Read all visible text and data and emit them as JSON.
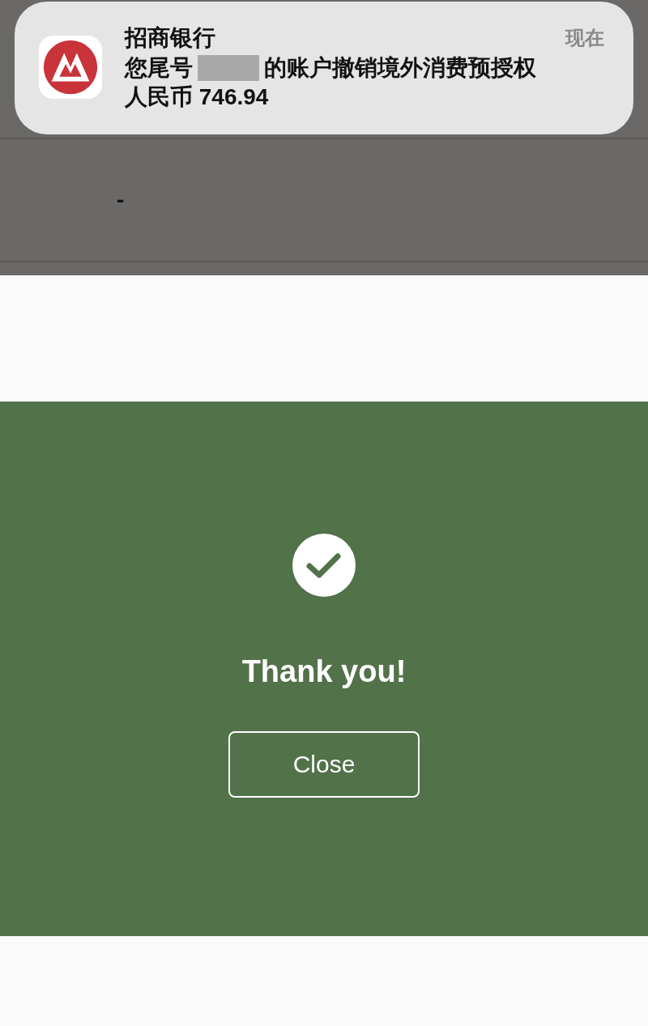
{
  "notification": {
    "app_name": "招商银行",
    "time": "现在",
    "message_start": "您尾号",
    "message_end": "的账户撤销境外消费预授权",
    "amount": "人民币 746.94"
  },
  "background": {
    "dash": "-"
  },
  "dialog": {
    "title": "Thank you!",
    "button": "Close"
  }
}
